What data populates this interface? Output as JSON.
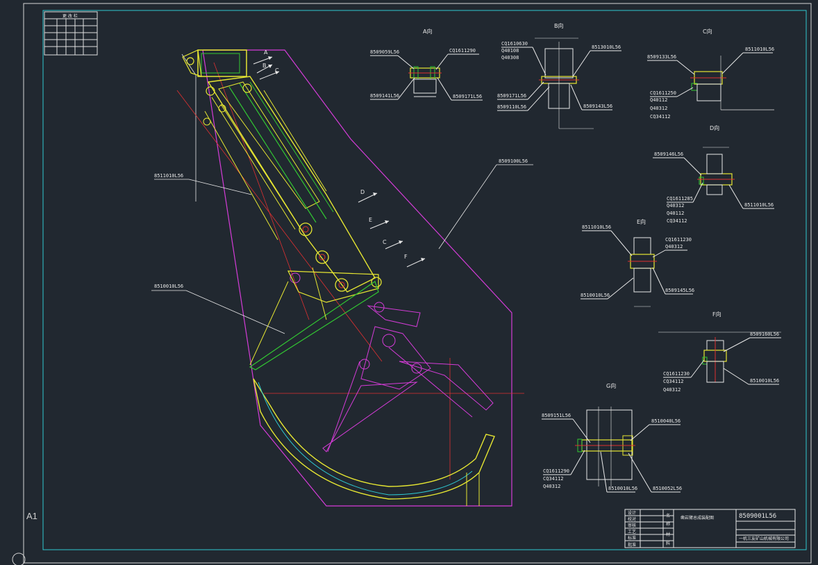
{
  "sheet": {
    "size": "A1"
  },
  "revision_table": {
    "title": "更 改 栏"
  },
  "section_titles": [
    "A向",
    "B向",
    "C向",
    "D向",
    "E向",
    "F向",
    "G向"
  ],
  "view_arrows": [
    "A",
    "B",
    "C",
    "D",
    "E",
    "C",
    "F"
  ],
  "main_leaders": [
    "8511010L56",
    "8510010L56",
    "8509100L56"
  ],
  "section_A": {
    "left_top": "8509059L56",
    "left_bottom": "8509141L56",
    "right_top": "CQ1611290",
    "right_bottom": "8509171L56"
  },
  "section_B": {
    "left": [
      "CQ1610630",
      "Q40108",
      "Q40308"
    ],
    "left_lower": [
      "8509171L56",
      "8509110L56"
    ],
    "right_top": "8513010L56",
    "right_bottom": "8509143L56"
  },
  "section_C": {
    "left_top": "8509133L56",
    "right_top": "8511010L56",
    "left_list": [
      "CQ1611250",
      "Q40112",
      "Q40312",
      "CQ34112"
    ]
  },
  "section_D": {
    "left_top": "8509146L56",
    "left_list": [
      "CQ1611285",
      "Q40312",
      "Q40112",
      "CQ34112"
    ],
    "right": "8511010L56"
  },
  "section_E": {
    "left_top": "8511010L56",
    "right_top": [
      "CQ1611230",
      "Q40312"
    ],
    "right_bottom": "8509145L56",
    "left_bottom": "8510010L56"
  },
  "section_F": {
    "right_top": "8509160L56",
    "left_list": [
      "CQ1611230",
      "CQ34112",
      "Q40312"
    ],
    "right_bottom": "8510010L56"
  },
  "section_G": {
    "left_top": "8509151L56",
    "right_top": "8510040L56",
    "left_list": [
      "CQ1611290",
      "CQ34112",
      "Q40312"
    ],
    "bottom_mid": "8510010L56",
    "right_bottom": "8510052L56"
  },
  "title_block": {
    "drawing_number": "8509001L56",
    "drawing_name": "凿岩臂总成装配图",
    "company": "一机三友矿山机械有限公司",
    "left_rows": [
      "设计",
      "校对",
      "审核",
      "工艺",
      "标准",
      "批准"
    ],
    "vertical_labels": [
      "名",
      "称",
      "材",
      "料"
    ]
  }
}
